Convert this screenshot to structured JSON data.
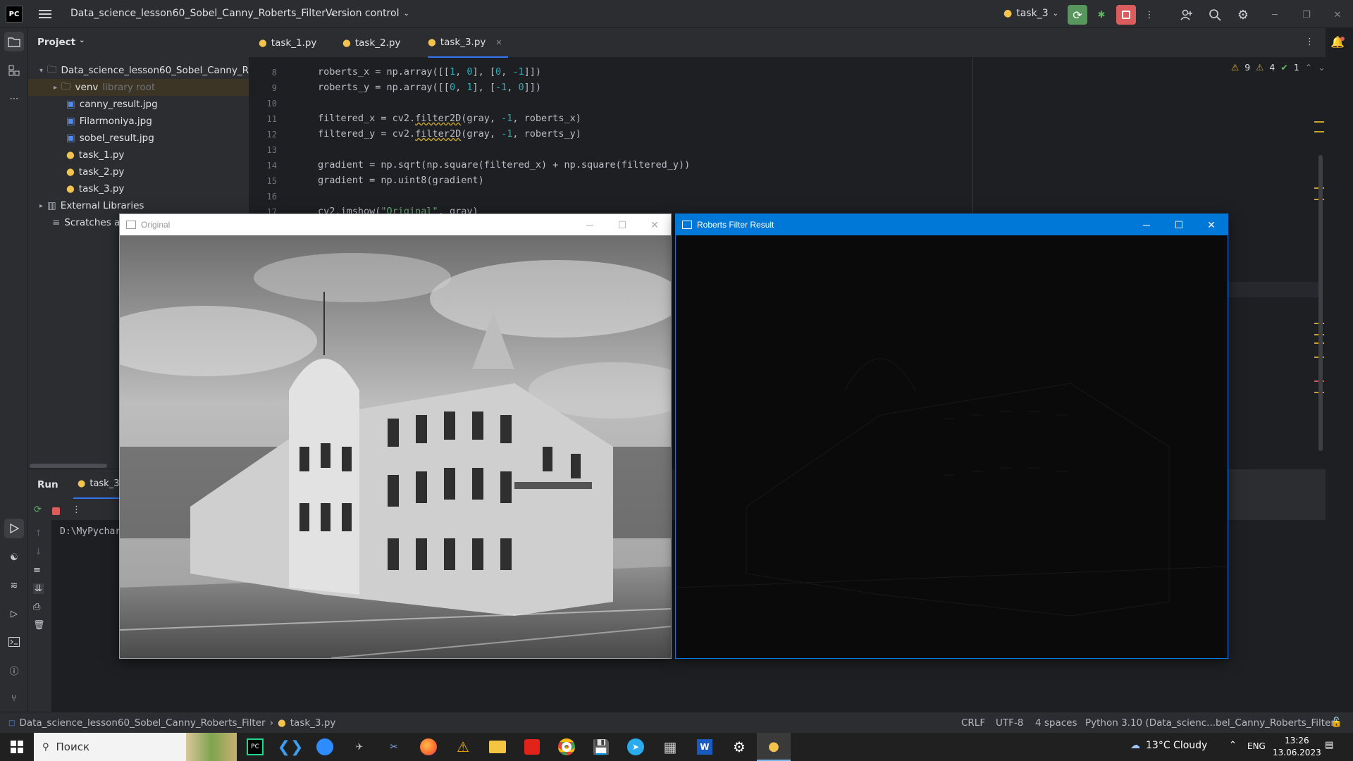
{
  "titlebar": {
    "project_name": "Data_science_lesson60_Sobel_Canny_Roberts_Filter",
    "vcs": "Version control",
    "run_config": "task_3"
  },
  "project_panel": {
    "title": "Project",
    "tree": [
      {
        "label": "Data_science_lesson60_Sobel_Canny_Rob",
        "kind": "folder",
        "indent": 0
      },
      {
        "label": "venv",
        "hint": "library root",
        "kind": "folder",
        "indent": 1
      },
      {
        "label": "canny_result.jpg",
        "kind": "image",
        "indent": 2
      },
      {
        "label": "Filarmoniya.jpg",
        "kind": "image",
        "indent": 2
      },
      {
        "label": "sobel_result.jpg",
        "kind": "image",
        "indent": 2
      },
      {
        "label": "task_1.py",
        "kind": "python",
        "indent": 2
      },
      {
        "label": "task_2.py",
        "kind": "python",
        "indent": 2
      },
      {
        "label": "task_3.py",
        "kind": "python",
        "indent": 2
      },
      {
        "label": "External Libraries",
        "kind": "library",
        "indent": 0
      },
      {
        "label": "Scratches ar",
        "kind": "scratch",
        "indent": 0
      }
    ]
  },
  "tabs": [
    {
      "label": "task_1.py",
      "active": false
    },
    {
      "label": "task_2.py",
      "active": false
    },
    {
      "label": "task_3.py",
      "active": true
    }
  ],
  "inspections": {
    "warnings": "9",
    "weak": "4",
    "ok": "1"
  },
  "code": [
    {
      "ln": "8",
      "text": "roberts_x = np.array([[1, 0], [0, -1]])"
    },
    {
      "ln": "9",
      "text": "roberts_y = np.array([[0, 1], [-1, 0]])"
    },
    {
      "ln": "10",
      "text": ""
    },
    {
      "ln": "11",
      "text": "filtered_x = cv2.filter2D(gray, -1, roberts_x)"
    },
    {
      "ln": "12",
      "text": "filtered_y = cv2.filter2D(gray, -1, roberts_y)"
    },
    {
      "ln": "13",
      "text": ""
    },
    {
      "ln": "14",
      "text": "gradient = np.sqrt(np.square(filtered_x) + np.square(filtered_y))"
    },
    {
      "ln": "15",
      "text": "gradient = np.uint8(gradient)"
    },
    {
      "ln": "16",
      "text": ""
    },
    {
      "ln": "17",
      "text": "cv2.imshow(\"Original\", gray)"
    }
  ],
  "run": {
    "tab_label": "Run",
    "config": "task_3",
    "console_text": "D:\\MyPychar"
  },
  "windows": {
    "original": {
      "title": "Original"
    },
    "roberts": {
      "title": "Roberts Filter Result"
    }
  },
  "statusbar": {
    "breadcrumb_project": "Data_science_lesson60_Sobel_Canny_Roberts_Filter",
    "breadcrumb_file": "task_3.py",
    "line_sep": "CRLF",
    "encoding": "UTF-8",
    "indent": "4 spaces",
    "interpreter": "Python 3.10 (Data_scienc...bel_Canny_Roberts_Filter)"
  },
  "taskbar": {
    "search_placeholder": "Поиск",
    "weather": "13°C  Cloudy",
    "lang": "ENG",
    "time": "13:26",
    "date": "13.06.2023"
  },
  "colors": {
    "accent": "#3574f0",
    "win_active": "#0078d7"
  }
}
